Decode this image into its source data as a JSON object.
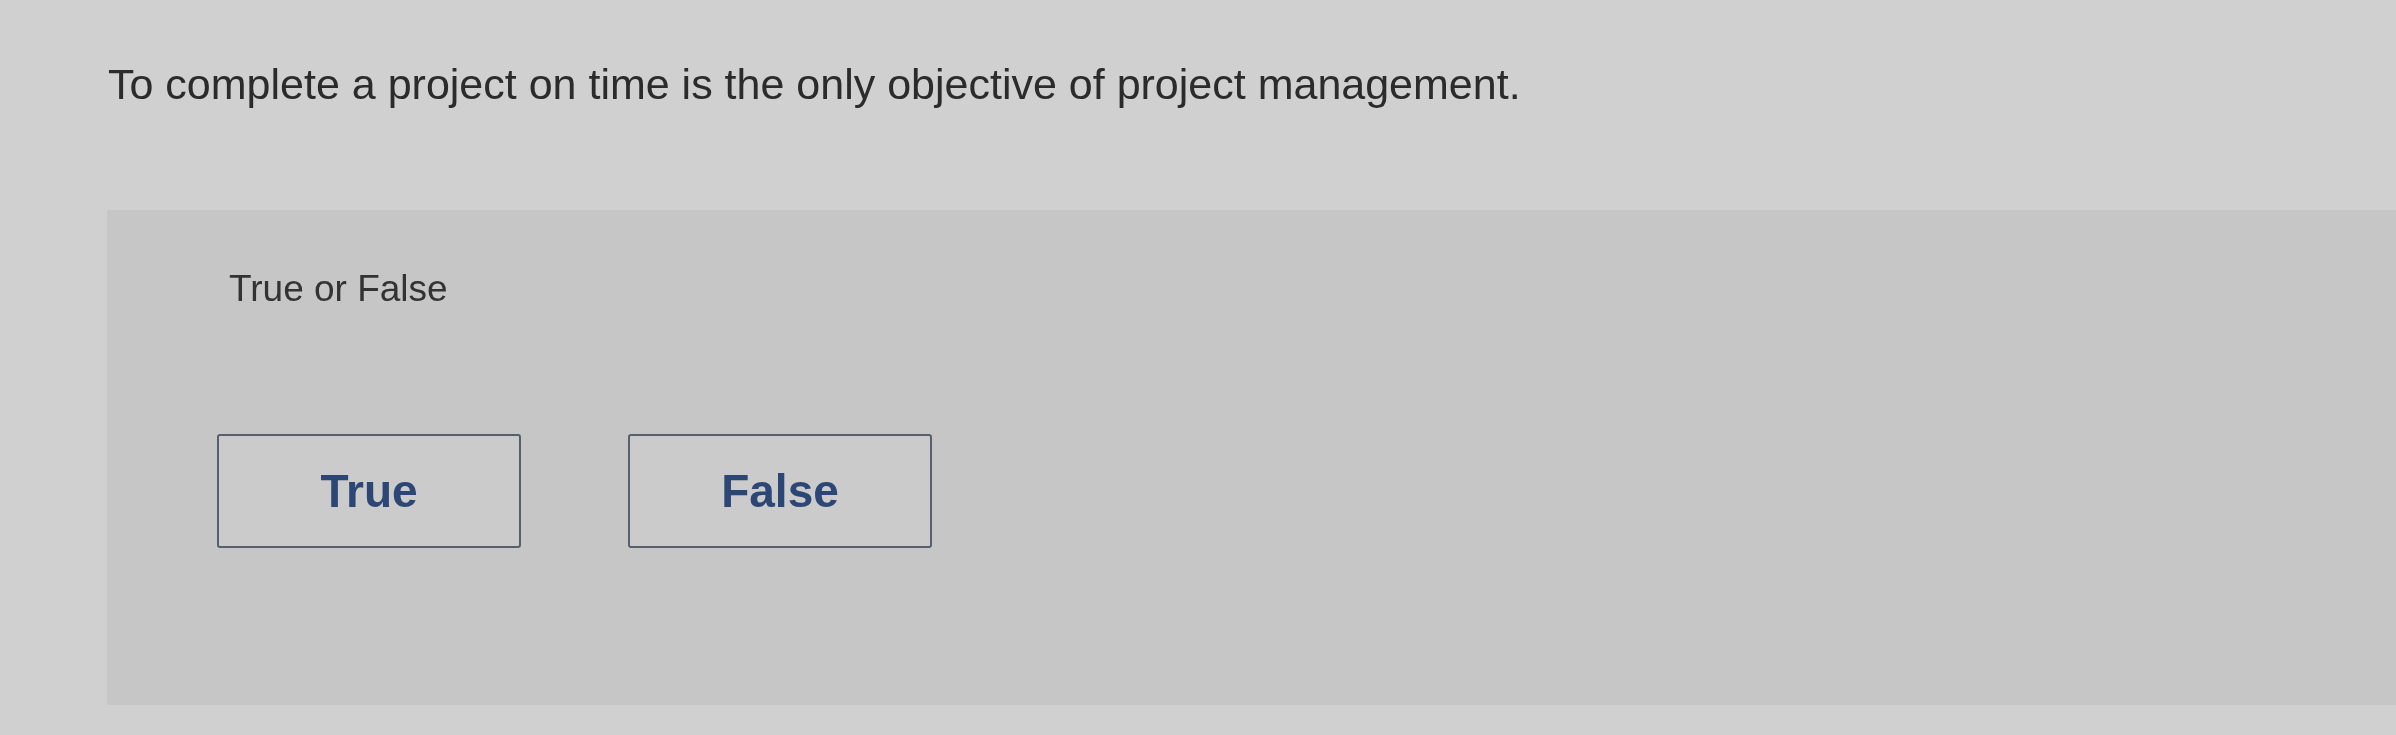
{
  "question": {
    "text": "To complete a project on time is the only objective of project management."
  },
  "answer_panel": {
    "prompt": "True or False",
    "options": [
      {
        "label": "True"
      },
      {
        "label": "False"
      }
    ]
  }
}
